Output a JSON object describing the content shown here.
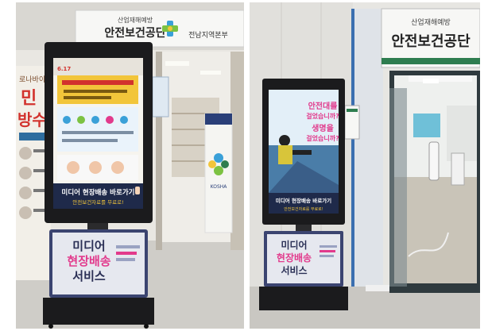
{
  "left_photo": {
    "building_sign": {
      "slogan": "산업재해예방",
      "name": "안전보건공단",
      "branch": "전남지역본부"
    },
    "kiosk_screen": {
      "topline": "6.17",
      "headline": "미디어 현장배송 바로가기",
      "subline": "안전보건자료를 무료로!"
    },
    "kiosk_base": {
      "line1": "미디어",
      "line2": "현장배송",
      "line3": "서비스"
    },
    "banner": {
      "text1": "민",
      "text2": "방수",
      "brand": "KOSHA"
    }
  },
  "right_photo": {
    "building_sign": {
      "slogan": "산업재해예방",
      "name": "안전보건공단"
    },
    "kiosk_screen": {
      "question1": "안전대를",
      "question2": "걸었습니까?",
      "question3": "생명을",
      "question4": "걸었습니까?",
      "headline": "미디어 현장배송 바로가기",
      "subline": "안전보건자료를 무료로!"
    },
    "kiosk_base": {
      "line1": "미디어",
      "line2": "현장배송",
      "line3": "서비스"
    }
  },
  "colors": {
    "sign_green": "#2e7d4f",
    "kiosk_black": "#1b1b1d",
    "kiosk_base_navy": "#3b4470",
    "screen_yellow": "#f2c53a",
    "accent_magenta": "#e23a8c"
  }
}
